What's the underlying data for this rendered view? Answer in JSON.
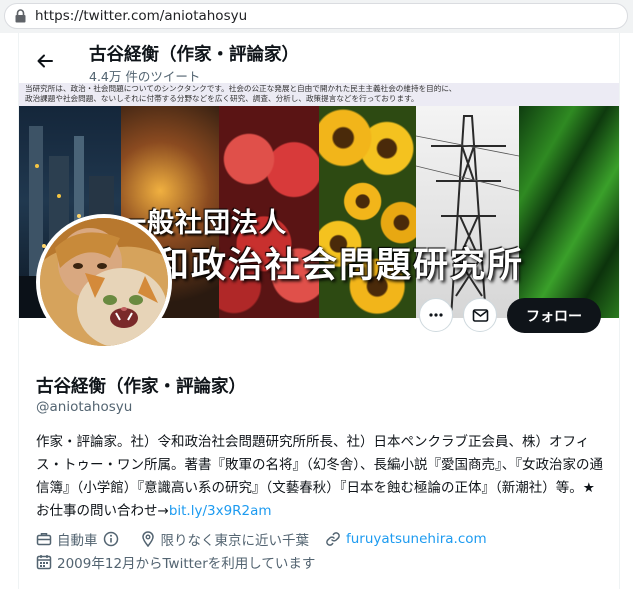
{
  "browser": {
    "url": "https://twitter.com/aniotahosyu"
  },
  "header": {
    "name": "古谷経衡（作家・評論家）",
    "tweet_count": "4.4万 件のツイート"
  },
  "banner": {
    "strip_text": "当研究所は、政治・社会問題についてのシンクタンクです。社会の公正な発展と自由で開かれた民主主義社会の維持を目的に、\n政治課題や社会問題、ないしそれに付帯する分野などを広く研究、調査、分析し、政策提言などを行っております。",
    "title_line1": "一般社団法人",
    "title_line2": "令和政治社会問題研究所"
  },
  "actions": {
    "follow_label": "フォロー"
  },
  "profile": {
    "name": "古谷経衡（作家・評論家）",
    "handle": "@aniotahosyu",
    "bio_text": "作家・評論家。社）令和政治社会問題研究所所長、社）日本ペンクラブ正会員、株）オフィス・トゥー・ワン所属。著書『敗軍の名将』（幻冬舎）、長編小説『愛国商売』、『女政治家の通信簿』（小学館）『意識高い系の研究』（文藝春秋）『日本を蝕む極論の正体』（新潮社）等。★お仕事の問い合わせ→",
    "bio_link": "bit.ly/3x9R2am",
    "category": "自動車",
    "location": "限りなく東京に近い千葉",
    "website": "furuyatsunehira.com",
    "joined": "2009年12月からTwitterを利用しています"
  },
  "icons": {
    "lock": "lock-icon",
    "back": "back-arrow-icon",
    "more": "more-icon",
    "mail": "mail-icon",
    "category": "briefcase-icon",
    "info": "info-icon",
    "location": "location-pin-icon",
    "link": "link-icon",
    "calendar": "calendar-icon"
  },
  "colors": {
    "link": "#1d9bf0",
    "follow_bg": "#0f1419",
    "secondary_text": "#536471"
  }
}
